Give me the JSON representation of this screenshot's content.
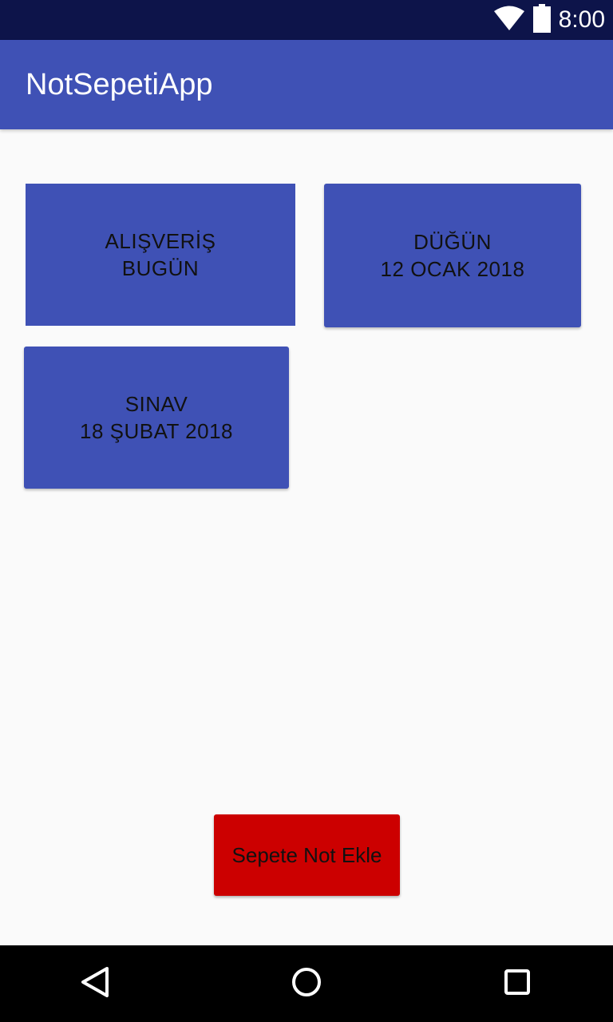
{
  "status_bar": {
    "time": "8:00",
    "icons": [
      "wifi-icon",
      "battery-icon"
    ]
  },
  "app_bar": {
    "title": "NotSepetiApp"
  },
  "notes": [
    {
      "line1": "ALIŞVERİŞ",
      "line2": "BUGÜN"
    },
    {
      "line1": "DÜĞÜN",
      "line2": "12 OCAK 2018"
    },
    {
      "line1": "SINAV",
      "line2": "18 ŞUBAT 2018"
    }
  ],
  "add_button": {
    "label": "Sepete Not Ekle"
  },
  "nav_bar": {
    "icons": [
      "back-icon",
      "home-icon",
      "recents-icon"
    ]
  },
  "colors": {
    "status_bar": "#0d144a",
    "app_bar": "#3f51b5",
    "note_card": "#3f51b5",
    "add_button": "#cc0000",
    "background": "#fafafa",
    "nav_bar": "#000000"
  }
}
